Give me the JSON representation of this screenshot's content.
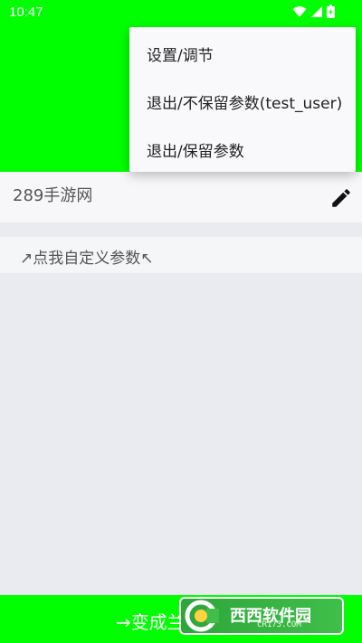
{
  "status_bar": {
    "time": "10:47",
    "icons": [
      "wifi-icon",
      "signal-icon",
      "battery-icon"
    ]
  },
  "menu": {
    "items": [
      {
        "label": "设置/调节"
      },
      {
        "label": "退出/不保留参数(test_user)"
      },
      {
        "label": "退出/保留参数"
      }
    ]
  },
  "input_row": {
    "text": "289手游网",
    "icon": "edit-icon"
  },
  "param_row": {
    "label": "↗点我自定义参数↖"
  },
  "bottom_bar": {
    "label": "→变成兰"
  },
  "watermark": {
    "text": "西西软件园",
    "url": "CR173.COM"
  },
  "colors": {
    "accent_green": "#00ff00",
    "background": "#e9ebf0",
    "row_background": "#f7f7f9",
    "menu_background": "#f9f9fb"
  }
}
